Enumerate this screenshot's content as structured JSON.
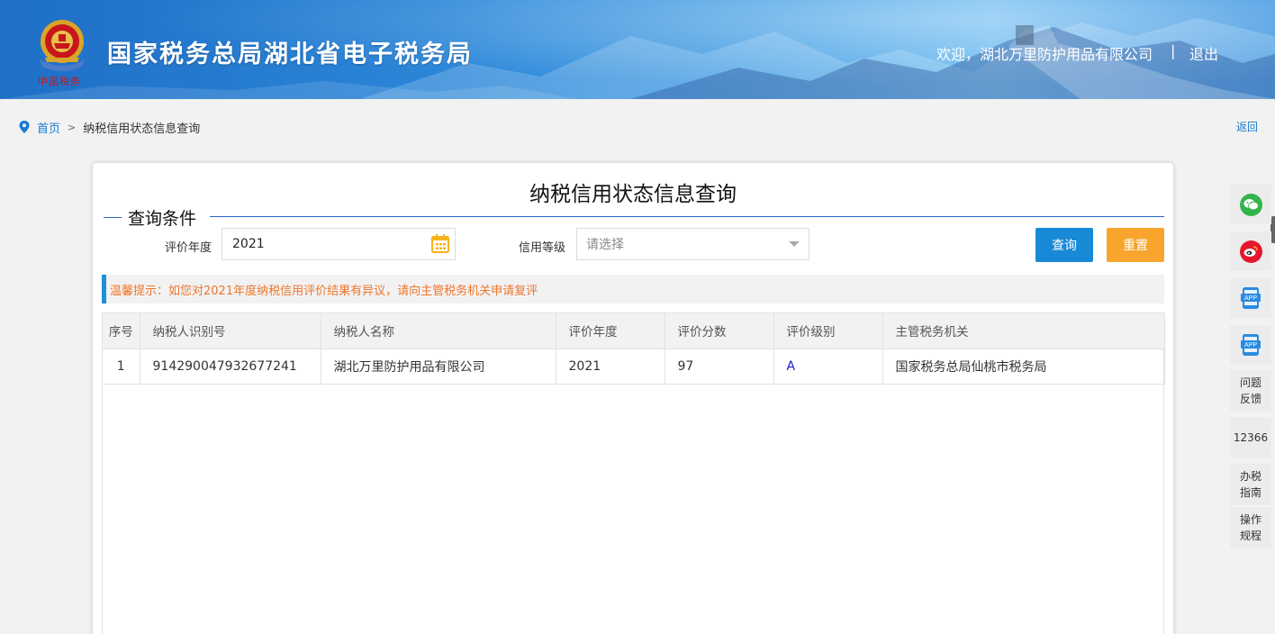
{
  "header": {
    "site_title": "国家税务总局湖北省电子税务局",
    "emblem_sub": "中国税务",
    "welcome": "欢迎，湖北万里防护用品有限公司",
    "separator": "|",
    "logout": "退出"
  },
  "breadcrumb": {
    "home": "首页",
    "arrow": ">",
    "current": "纳税信用状态信息查询",
    "back": "返回"
  },
  "page": {
    "title": "纳税信用状态信息查询",
    "section_label": "查询条件"
  },
  "form": {
    "year_label": "评价年度",
    "year_value": "2021",
    "grade_label": "信用等级",
    "grade_placeholder": "请选择",
    "query_button": "查询",
    "reset_button": "重置"
  },
  "tip": "温馨提示：如您对2021年度纳税信用评价结果有异议，请向主管税务机关申请复评",
  "table": {
    "headers": [
      "序号",
      "纳税人识别号",
      "纳税人名称",
      "评价年度",
      "评价分数",
      "评价级别",
      "主管税务机关"
    ],
    "rows": [
      [
        "1",
        "914290047932677241",
        "湖北万里防护用品有限公司",
        "2021",
        "97",
        "A",
        "国家税务总局仙桃市税务局"
      ]
    ]
  },
  "sidebar": {
    "items": [
      {
        "icon": "wechat-icon",
        "color": "#33b44a"
      },
      {
        "icon": "weibo-icon",
        "color": "#e6162d"
      },
      {
        "icon": "app-icon",
        "label": "APP",
        "color": "#2a8be0"
      },
      {
        "icon": "app-icon",
        "label": "APP",
        "color": "#2a8be0"
      },
      {
        "label_line1": "问题",
        "label_line2": "反馈"
      },
      {
        "label": "12366"
      },
      {
        "label_line1": "办税",
        "label_line2": "指南"
      },
      {
        "label_line1": "操作",
        "label_line2": "规程"
      }
    ]
  }
}
